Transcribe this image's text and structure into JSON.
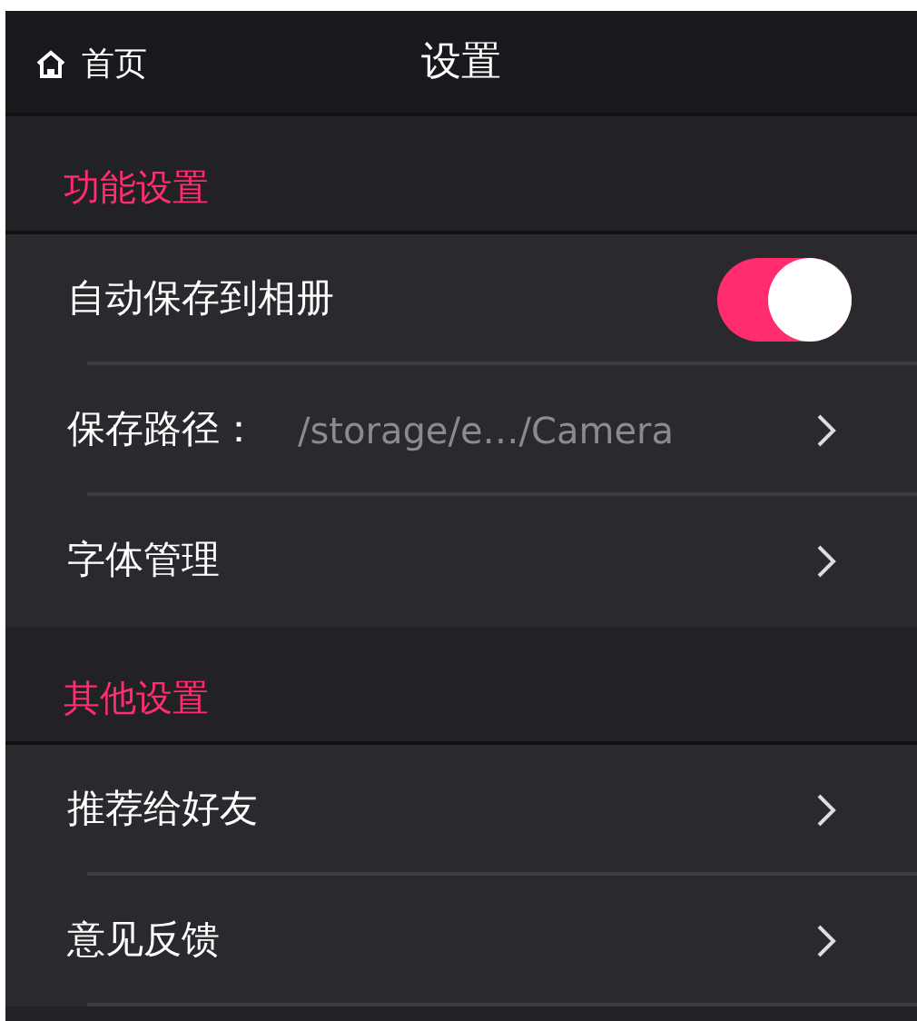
{
  "header": {
    "back_label": "首页",
    "title": "设置"
  },
  "sections": [
    {
      "title": "功能设置",
      "items": [
        {
          "kind": "toggle",
          "label": "自动保存到相册",
          "on": true
        },
        {
          "kind": "link",
          "label": "保存路径：",
          "value": "/storage/e…/Camera"
        },
        {
          "kind": "link",
          "label": "字体管理"
        }
      ]
    },
    {
      "title": "其他设置",
      "items": [
        {
          "kind": "link",
          "label": "推荐给好友"
        },
        {
          "kind": "link",
          "label": "意见反馈"
        }
      ]
    }
  ]
}
